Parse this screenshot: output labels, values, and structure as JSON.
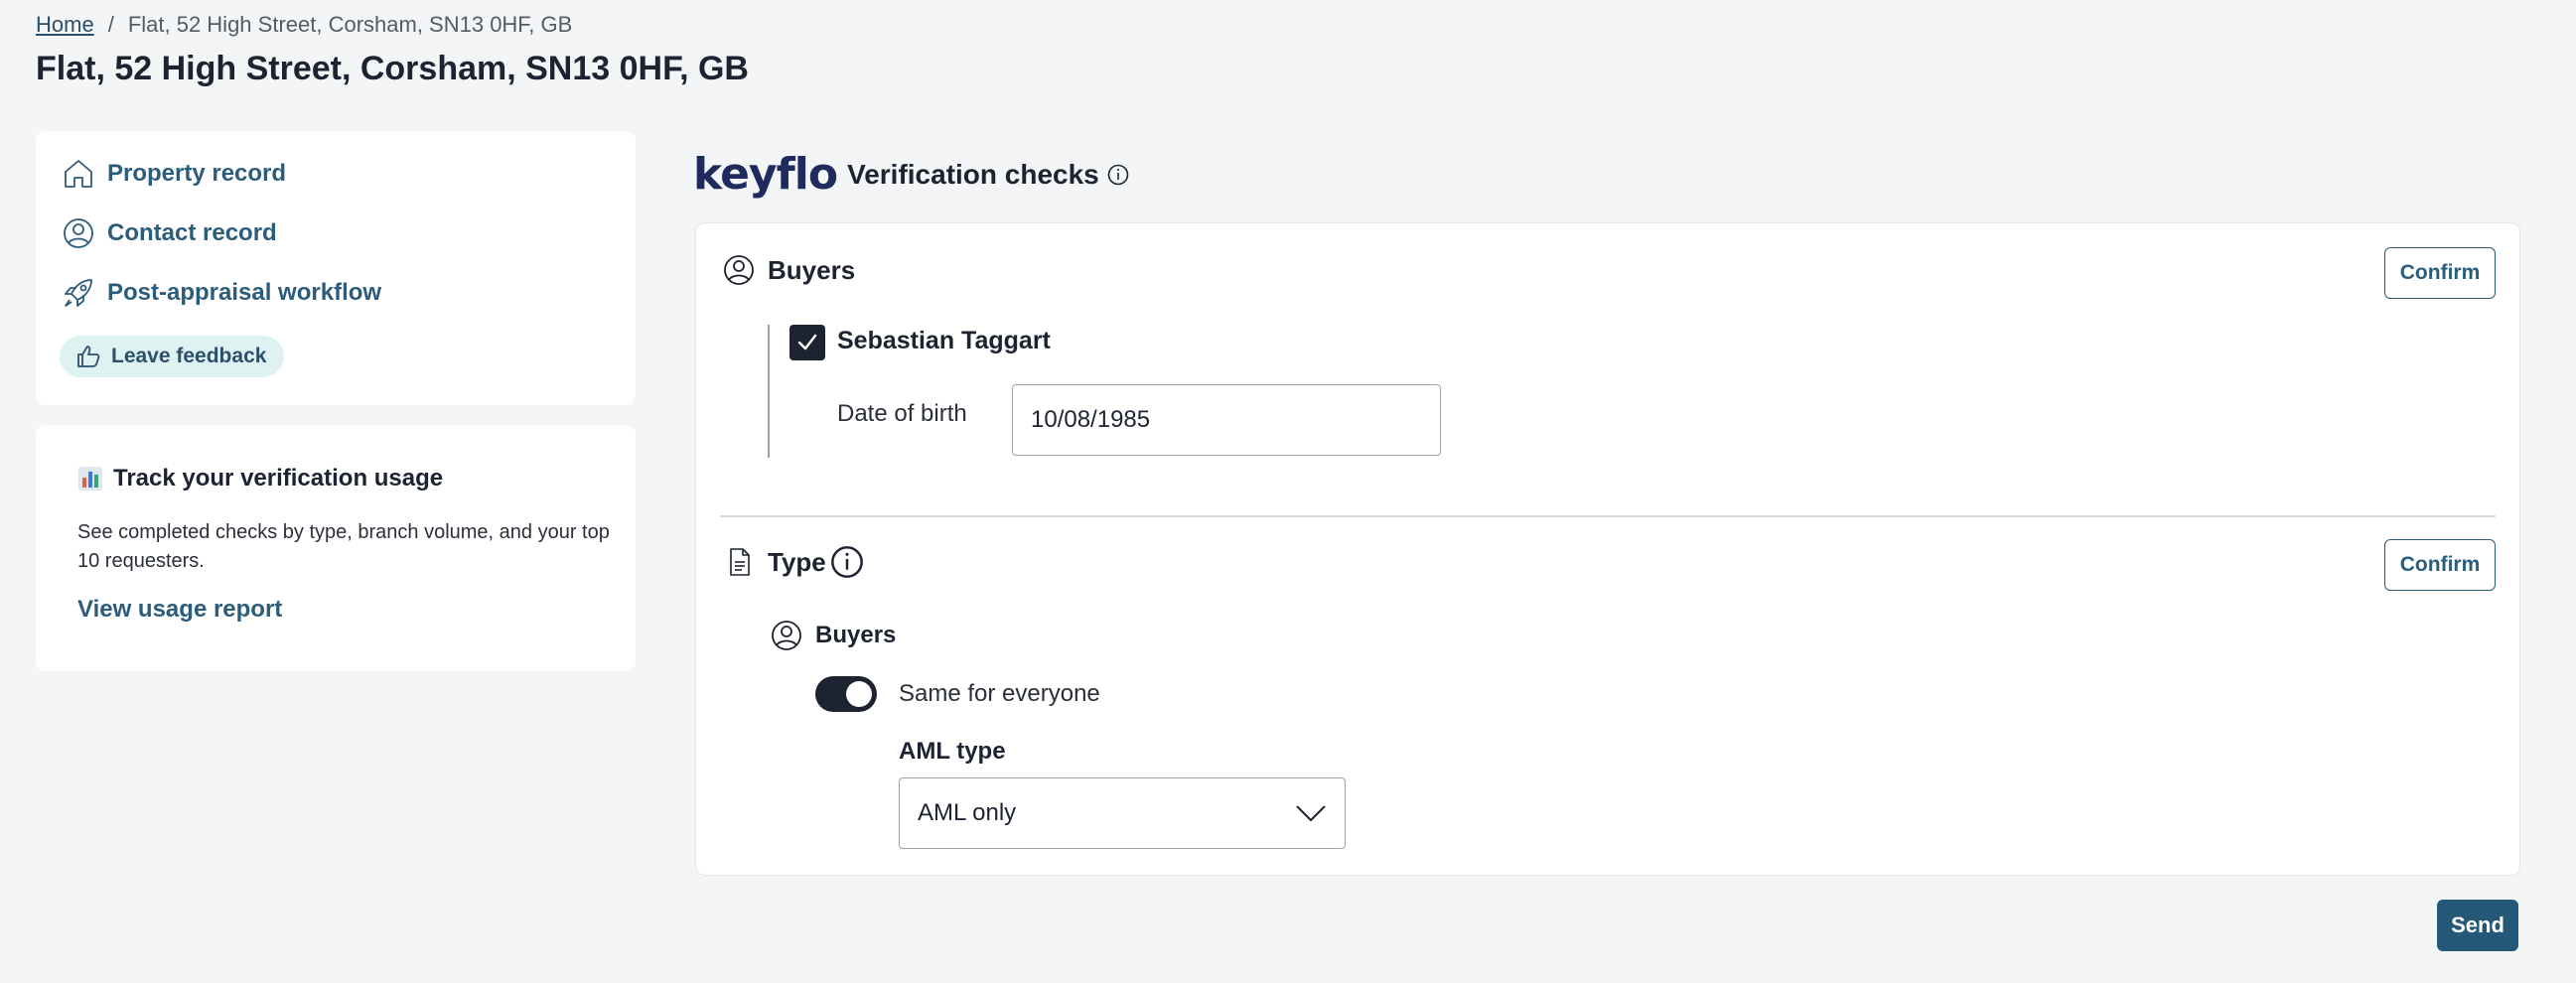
{
  "breadcrumb": {
    "home": "Home",
    "separator": "/",
    "current": "Flat, 52 High Street, Corsham, SN13 0HF, GB"
  },
  "page": {
    "title": "Flat, 52 High Street, Corsham, SN13 0HF, GB"
  },
  "sidebar": {
    "items": [
      {
        "label": "Property record",
        "icon": "home-icon"
      },
      {
        "label": "Contact record",
        "icon": "user-circle-icon"
      },
      {
        "label": "Post-appraisal workflow",
        "icon": "rocket-icon"
      }
    ],
    "feedback": {
      "label": "Leave feedback",
      "icon": "thumbs-up-icon"
    }
  },
  "usage": {
    "icon": "bar-chart-icon",
    "title": "Track your verification usage",
    "description": "See completed checks by type, branch volume, and your top 10 requesters.",
    "link": "View usage report"
  },
  "main": {
    "logo": "keyflo",
    "heading": "Verification checks",
    "buyers_section": {
      "title": "Buyers",
      "confirm": "Confirm",
      "buyer": {
        "name": "Sebastian Taggart",
        "checked": true,
        "dob_label": "Date of birth",
        "dob_value": "10/08/1985"
      }
    },
    "type_section": {
      "title": "Type",
      "confirm": "Confirm",
      "sub_title": "Buyers",
      "toggle_label": "Same for everyone",
      "toggle_on": true,
      "aml_label": "AML type",
      "aml_value": "AML only"
    },
    "send": "Send"
  },
  "colors": {
    "accent": "#2c5c7c",
    "primary_button": "#245877",
    "dark": "#1d2331",
    "pill_bg": "#dff2f2"
  }
}
